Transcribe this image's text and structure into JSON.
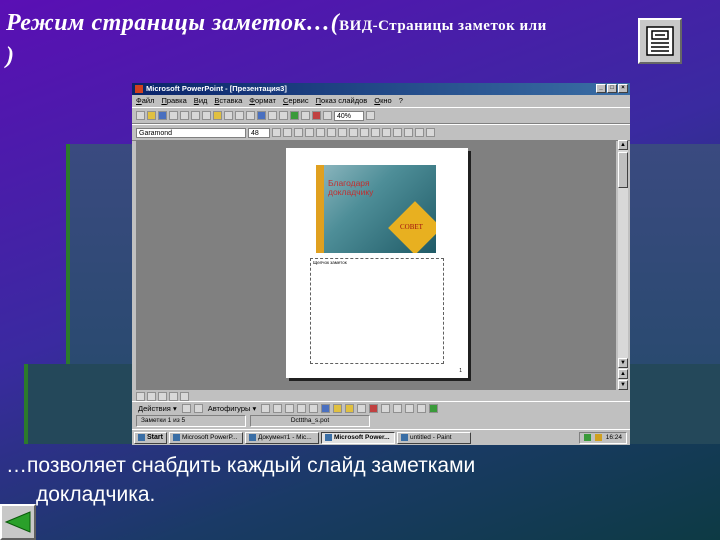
{
  "slide": {
    "title_main": "Режим страницы заметок…(",
    "title_sub": "ВИД-Страницы заметок или",
    "title_end": ")",
    "body_line1": "…позволяет снабдить каждый слайд заметками",
    "body_line2": "докладчика."
  },
  "icons": {
    "corner": "notes-page-view-icon",
    "nav": "back-triangle-icon"
  },
  "window": {
    "title": "Microsoft PowerPoint - [Презентация3]",
    "menu": [
      "Файл",
      "Правка",
      "Вид",
      "Вставка",
      "Формат",
      "Сервис",
      "Показ слайдов",
      "Окно",
      "?"
    ],
    "font_name": "Garamond",
    "font_size": "48",
    "zoom": "40%",
    "draw_actions": "Действия ▾",
    "draw_autoshapes": "Автофигуры ▾"
  },
  "thumbnail": {
    "thanks_line1": "Благодаря",
    "thanks_line2": "докладчику",
    "sovet": "СОВЕТ"
  },
  "notes": {
    "label": "Щелчок заметок",
    "page_number": "1"
  },
  "status": {
    "page": "Заметки 1 из 5",
    "template": "Dctttha_s.pot"
  },
  "taskbar": {
    "start": "Start",
    "tasks": [
      "Microsoft PowerP...",
      "Документ1 - Mic...",
      "Microsoft Power...",
      "untitled - Paint"
    ],
    "active_index": 2,
    "clock": "16:24"
  }
}
